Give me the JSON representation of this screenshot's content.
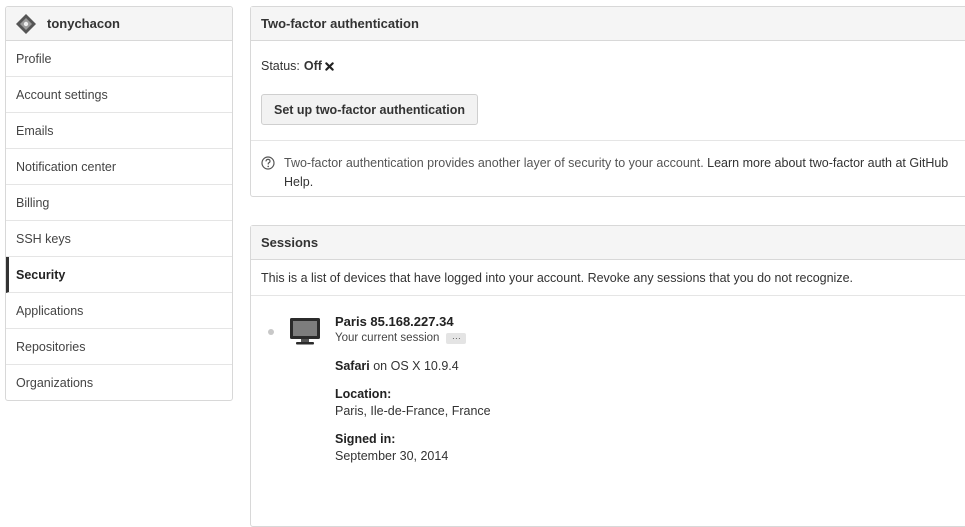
{
  "sidebar": {
    "username": "tonychacon",
    "items": [
      {
        "label": "Profile",
        "active": false
      },
      {
        "label": "Account settings",
        "active": false
      },
      {
        "label": "Emails",
        "active": false
      },
      {
        "label": "Notification center",
        "active": false
      },
      {
        "label": "Billing",
        "active": false
      },
      {
        "label": "SSH keys",
        "active": false
      },
      {
        "label": "Security",
        "active": true
      },
      {
        "label": "Applications",
        "active": false
      },
      {
        "label": "Repositories",
        "active": false
      },
      {
        "label": "Organizations",
        "active": false
      }
    ]
  },
  "two_factor": {
    "title": "Two-factor authentication",
    "status_label": "Status:",
    "status_value": "Off",
    "setup_button": "Set up two-factor authentication",
    "help_text": "Two-factor authentication provides another layer of security to your account.",
    "help_link": "Learn more about two-factor auth at GitHub Help."
  },
  "sessions": {
    "title": "Sessions",
    "description": "This is a list of devices that have logged into your account. Revoke any sessions that you do not recognize.",
    "current": {
      "location": "Paris 85.168.227.34",
      "current_label": "Your current session",
      "more_label": "···",
      "browser": "Safari",
      "os_text": "on OS X 10.9.4",
      "location_label": "Location:",
      "location_value": "Paris, Ile-de-France, France",
      "signed_in_label": "Signed in:",
      "signed_in_value": "September 30, 2014"
    }
  },
  "colors": {
    "header_bg": "#f5f5f5",
    "border": "#d8d8d8",
    "active_marker": "#333333"
  },
  "icons": {
    "avatar": "diamond-avatar-icon",
    "status_off": "x-icon",
    "help": "question-circle-icon",
    "session_device": "monitor-icon",
    "session_indicator": "status-dot"
  }
}
